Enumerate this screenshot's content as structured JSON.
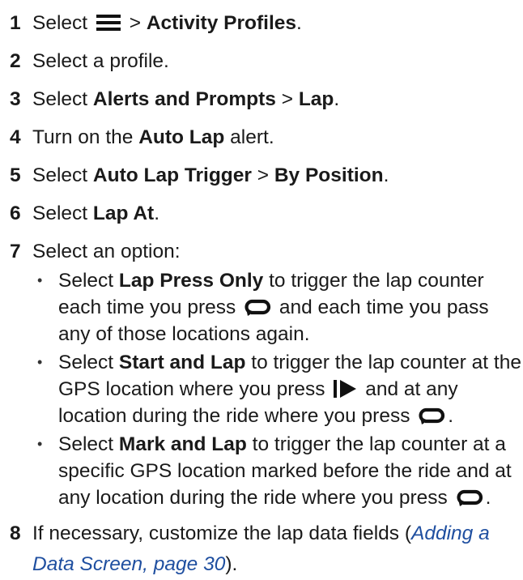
{
  "steps": [
    {
      "num": "1",
      "t1": "Select",
      "t2": ">",
      "b1": "Activity Profiles",
      "t3": "."
    },
    {
      "num": "2",
      "t1": "Select a profile."
    },
    {
      "num": "3",
      "t1": "Select",
      "b1": "Alerts and Prompts",
      "t2": ">",
      "b2": "Lap",
      "t3": "."
    },
    {
      "num": "4",
      "t1": "Turn on the",
      "b1": "Auto Lap",
      "t2": "alert."
    },
    {
      "num": "5",
      "t1": "Select",
      "b1": "Auto Lap Trigger",
      "t2": ">",
      "b2": "By Position",
      "t3": "."
    },
    {
      "num": "6",
      "t1": "Select",
      "b1": "Lap At",
      "t2": "."
    },
    {
      "num": "7",
      "t1": "Select an option:"
    },
    {
      "num": "8",
      "t1": "If necessary, customize the lap data fields (",
      "ref": "Adding a Data Screen, page 30",
      "t2": ")."
    }
  ],
  "options": [
    {
      "t1": "Select",
      "b1": "Lap Press Only",
      "t2": "to trigger the lap counter each time you press",
      "t3": "and each time you pass any of those locations again."
    },
    {
      "t1": "Select",
      "b1": "Start and Lap",
      "t2": "to trigger the lap counter at the GPS location where you press",
      "t3": "and at any location during the ride where you press",
      "t4": "."
    },
    {
      "t1": "Select",
      "b1": "Mark and Lap",
      "t2": "to trigger the lap counter at a specific GPS location marked before the ride and at any location during the ride where you press",
      "t3": "."
    }
  ],
  "icons": {
    "menu": "menu-icon",
    "lap": "lap-icon",
    "start": "play-icon"
  }
}
